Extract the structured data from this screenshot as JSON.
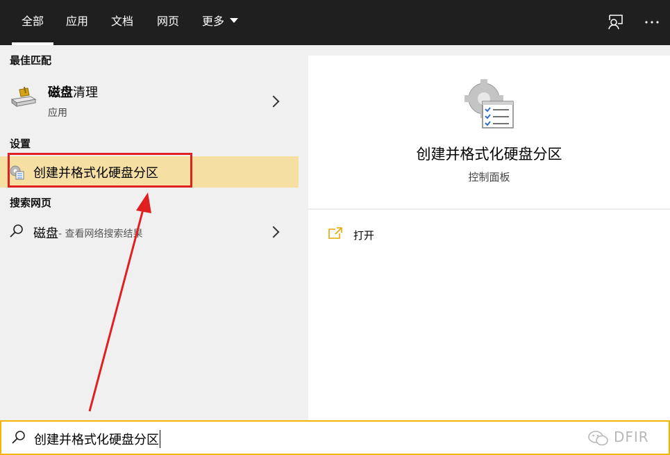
{
  "tabs": [
    {
      "label": "全部"
    },
    {
      "label": "应用"
    },
    {
      "label": "文档"
    },
    {
      "label": "网页"
    },
    {
      "label": "更多"
    }
  ],
  "best_match": {
    "header": "最佳匹配",
    "title_bold": "磁盘",
    "title_rest": "清理",
    "subtitle": "应用"
  },
  "settings": {
    "header": "设置",
    "item_label": "创建并格式化硬盘分区"
  },
  "web": {
    "header": "搜索网页",
    "query": "磁盘",
    "suffix": " - 查看网络搜索结果"
  },
  "detail": {
    "title": "创建并格式化硬盘分区",
    "subtitle": "控制面板",
    "open_label": "打开"
  },
  "search": {
    "value": "创建并格式化硬盘分区"
  },
  "watermark": "DFIR",
  "colors": {
    "selected_bg": "#f5dfa3",
    "highlight_box": "#e02020",
    "accent": "#f5b400",
    "arrow": "#e02020"
  }
}
